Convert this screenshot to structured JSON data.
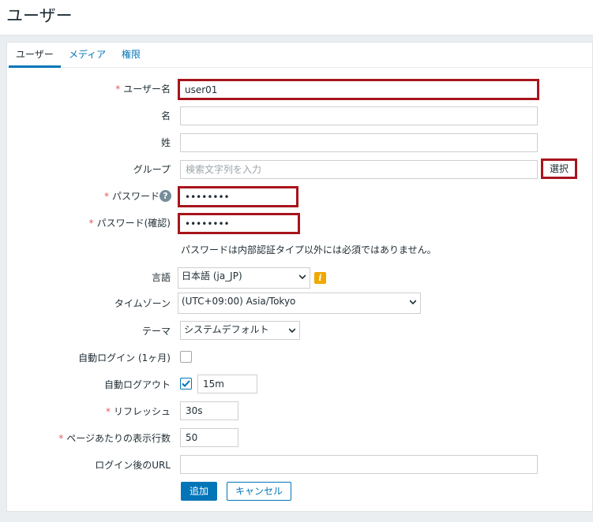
{
  "page": {
    "title": "ユーザー"
  },
  "tabs": [
    {
      "label": "ユーザー",
      "active": true
    },
    {
      "label": "メディア",
      "active": false
    },
    {
      "label": "権限",
      "active": false
    }
  ],
  "form": {
    "username": {
      "label": "ユーザー名",
      "value": "user01",
      "required": true
    },
    "first_name": {
      "label": "名",
      "value": ""
    },
    "last_name": {
      "label": "姓",
      "value": ""
    },
    "groups": {
      "label": "グループ",
      "placeholder": "検索文字列を入力",
      "select_label": "選択"
    },
    "password": {
      "label": "パスワード",
      "value": "••••••••",
      "required": true
    },
    "password_confirm": {
      "label": "パスワード(確認)",
      "value": "••••••••",
      "required": true
    },
    "password_hint": "パスワードは内部認証タイプ以外には必須ではありません。",
    "language": {
      "label": "言語",
      "value": "日本語 (ja_JP)"
    },
    "timezone": {
      "label": "タイムゾーン",
      "value": "(UTC+09:00) Asia/Tokyo"
    },
    "theme": {
      "label": "テーマ",
      "value": "システムデフォルト"
    },
    "autologin": {
      "label": "自動ログイン (1ヶ月)",
      "checked": false
    },
    "autologout": {
      "label": "自動ログアウト",
      "checked": true,
      "value": "15m"
    },
    "refresh": {
      "label": "リフレッシュ",
      "value": "30s",
      "required": true
    },
    "rows_per_page": {
      "label": "ページあたりの表示行数",
      "value": "50",
      "required": true
    },
    "url": {
      "label": "ログイン後のURL",
      "value": ""
    },
    "add_label": "追加",
    "cancel_label": "キャンセル"
  },
  "colors": {
    "accent": "#0275b8",
    "highlight": "#a8141c",
    "required": "#e45959",
    "info": "#f0a800"
  }
}
